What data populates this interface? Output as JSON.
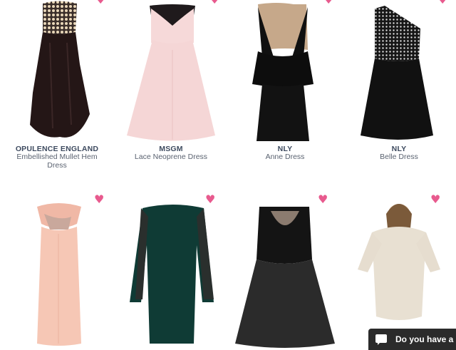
{
  "accent_color": "#e85a8e",
  "heart_icon": "heart-icon",
  "products_row1": [
    {
      "brand": "OPULENCE ENGLAND",
      "name_line1": "Embellished Mullet Hem",
      "name_line2": "Dress"
    },
    {
      "brand": "MSGM",
      "name_line1": "Lace Neoprene Dress",
      "name_line2": ""
    },
    {
      "brand": "NLY",
      "name_line1": "Anne Dress",
      "name_line2": ""
    },
    {
      "brand": "NLY",
      "name_line1": "Belle Dress",
      "name_line2": ""
    }
  ],
  "chat": {
    "label": "Do you have a"
  }
}
